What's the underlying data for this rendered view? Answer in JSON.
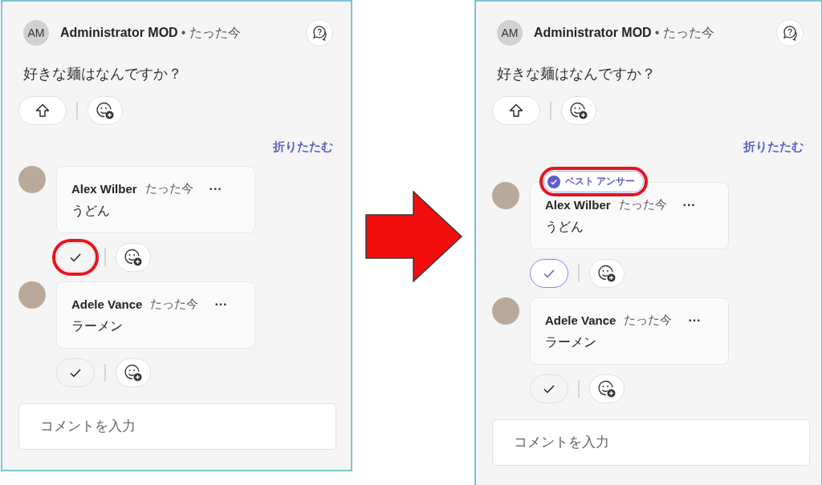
{
  "panels": [
    {
      "author": {
        "initials": "AM",
        "name": "Administrator MOD",
        "time": "• たった今"
      },
      "question": "好きな麺はなんですか？",
      "collapse_link": "折りたたむ",
      "replies": [
        {
          "name": "Alex Wilber",
          "time": "たった今",
          "more": "···",
          "text": "うどん",
          "check": {
            "selected": false,
            "highlighted": true
          }
        },
        {
          "name": "Adele Vance",
          "time": "たった今",
          "more": "···",
          "text": "ラーメン",
          "check": {
            "selected": false,
            "highlighted": false
          }
        }
      ],
      "comment_input": {
        "placeholder": "コメントを入力"
      }
    },
    {
      "author": {
        "initials": "AM",
        "name": "Administrator MOD",
        "time": "• たった今"
      },
      "question": "好きな麺はなんですか？",
      "collapse_link": "折りたたむ",
      "replies": [
        {
          "name": "Alex Wilber",
          "time": "たった今",
          "more": "···",
          "text": "うどん",
          "badge": {
            "label": "ベスト アンサー",
            "highlighted": true
          },
          "check": {
            "selected": true,
            "highlighted": false
          }
        },
        {
          "name": "Adele Vance",
          "time": "たった今",
          "more": "···",
          "text": "ラーメン",
          "check": {
            "selected": false,
            "highlighted": false
          }
        }
      ],
      "comment_input": {
        "placeholder": "コメントを入力"
      }
    }
  ]
}
